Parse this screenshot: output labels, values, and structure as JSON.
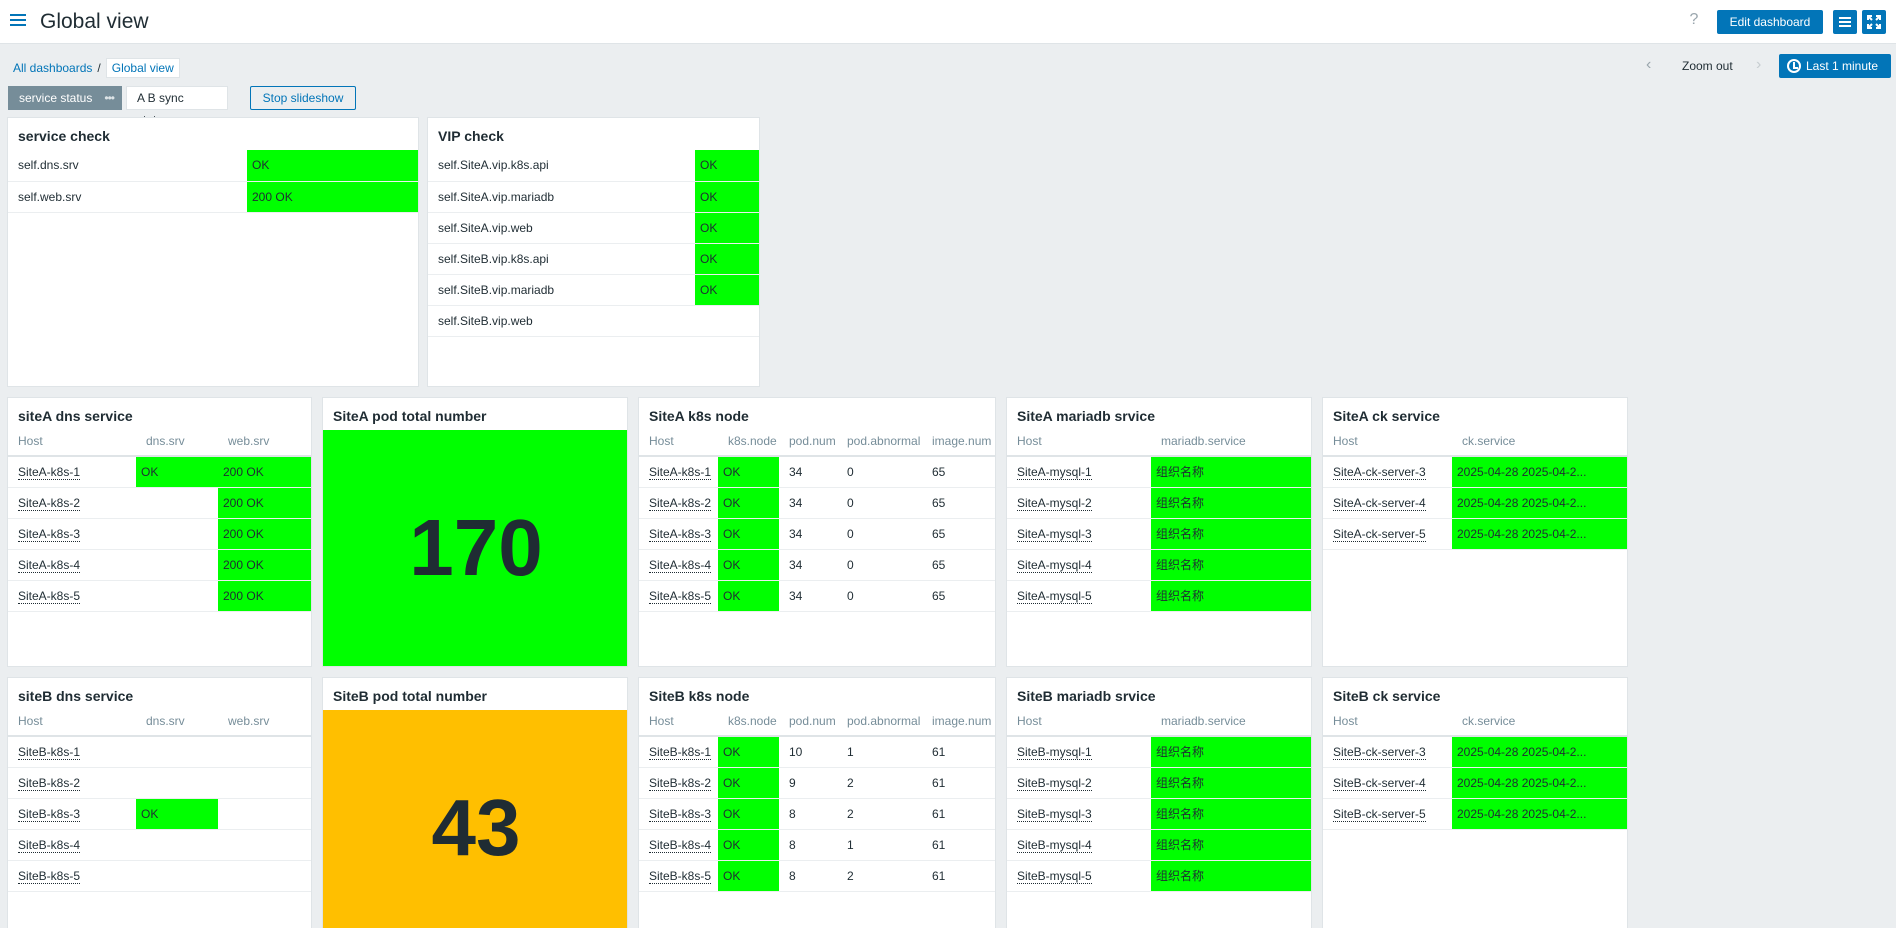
{
  "header": {
    "title": "Global view",
    "help_icon": "?",
    "edit_label": "Edit dashboard"
  },
  "breadcrumb": {
    "all": "All dashboards",
    "separator": "/",
    "current": "Global view"
  },
  "timebar": {
    "zoom_out": "Zoom out",
    "period": "Last 1 minute"
  },
  "tabs": {
    "tab1": "service status",
    "tab1_dots": "•••",
    "tab2": "A B sync status",
    "slideshow": "Stop slideshow"
  },
  "colors": {
    "ok": "#00ff00",
    "warning": "#ffbf00",
    "accent": "#0275b8"
  },
  "service_check": {
    "title": "service check",
    "rows": [
      {
        "name": "self.dns.srv",
        "value": "OK"
      },
      {
        "name": "self.web.srv",
        "value": "200 OK"
      }
    ]
  },
  "vip_check": {
    "title": "VIP check",
    "rows": [
      {
        "name": "self.SiteA.vip.k8s.api",
        "value": "OK"
      },
      {
        "name": "self.SiteA.vip.mariadb",
        "value": "OK"
      },
      {
        "name": "self.SiteA.vip.web",
        "value": "OK"
      },
      {
        "name": "self.SiteB.vip.k8s.api",
        "value": "OK"
      },
      {
        "name": "self.SiteB.vip.mariadb",
        "value": "OK"
      },
      {
        "name": "self.SiteB.vip.web",
        "value": ""
      }
    ]
  },
  "siteA_dns": {
    "title": "siteA dns service",
    "columns": [
      "Host",
      "dns.srv",
      "web.srv"
    ],
    "rows": [
      {
        "host": "SiteA-k8s-1",
        "dns": "OK",
        "web": "200 OK"
      },
      {
        "host": "SiteA-k8s-2",
        "dns": "",
        "web": "200 OK"
      },
      {
        "host": "SiteA-k8s-3",
        "dns": "",
        "web": "200 OK"
      },
      {
        "host": "SiteA-k8s-4",
        "dns": "",
        "web": "200 OK"
      },
      {
        "host": "SiteA-k8s-5",
        "dns": "",
        "web": "200 OK"
      }
    ]
  },
  "siteA_pods": {
    "title": "SiteA pod total number",
    "value": "170"
  },
  "siteA_k8s": {
    "title": "SiteA k8s node",
    "columns": [
      "Host",
      "k8s.node",
      "pod.num",
      "pod.abnormal",
      "image.num"
    ],
    "rows": [
      {
        "host": "SiteA-k8s-1",
        "node": "OK",
        "pod": "34",
        "abn": "0",
        "img": "65"
      },
      {
        "host": "SiteA-k8s-2",
        "node": "OK",
        "pod": "34",
        "abn": "0",
        "img": "65"
      },
      {
        "host": "SiteA-k8s-3",
        "node": "OK",
        "pod": "34",
        "abn": "0",
        "img": "65"
      },
      {
        "host": "SiteA-k8s-4",
        "node": "OK",
        "pod": "34",
        "abn": "0",
        "img": "65"
      },
      {
        "host": "SiteA-k8s-5",
        "node": "OK",
        "pod": "34",
        "abn": "0",
        "img": "65"
      }
    ]
  },
  "siteA_mariadb": {
    "title": "SiteA mariadb srvice",
    "columns": [
      "Host",
      "mariadb.service"
    ],
    "rows": [
      {
        "host": "SiteA-mysql-1",
        "svc": "组织名称"
      },
      {
        "host": "SiteA-mysql-2",
        "svc": "组织名称"
      },
      {
        "host": "SiteA-mysql-3",
        "svc": "组织名称"
      },
      {
        "host": "SiteA-mysql-4",
        "svc": "组织名称"
      },
      {
        "host": "SiteA-mysql-5",
        "svc": "组织名称"
      }
    ]
  },
  "siteA_ck": {
    "title": "SiteA ck service",
    "columns": [
      "Host",
      "ck.service"
    ],
    "rows": [
      {
        "host": "SiteA-ck-server-3",
        "svc": "2025-04-28 2025-04-2..."
      },
      {
        "host": "SiteA-ck-server-4",
        "svc": "2025-04-28 2025-04-2..."
      },
      {
        "host": "SiteA-ck-server-5",
        "svc": "2025-04-28 2025-04-2..."
      }
    ]
  },
  "siteB_dns": {
    "title": "siteB dns service",
    "columns": [
      "Host",
      "dns.srv",
      "web.srv"
    ],
    "rows": [
      {
        "host": "SiteB-k8s-1",
        "dns": "",
        "web": ""
      },
      {
        "host": "SiteB-k8s-2",
        "dns": "",
        "web": ""
      },
      {
        "host": "SiteB-k8s-3",
        "dns": "OK",
        "web": ""
      },
      {
        "host": "SiteB-k8s-4",
        "dns": "",
        "web": ""
      },
      {
        "host": "SiteB-k8s-5",
        "dns": "",
        "web": ""
      }
    ]
  },
  "siteB_pods": {
    "title": "SiteB pod total number",
    "value": "43"
  },
  "siteB_k8s": {
    "title": "SiteB k8s node",
    "columns": [
      "Host",
      "k8s.node",
      "pod.num",
      "pod.abnormal",
      "image.num"
    ],
    "rows": [
      {
        "host": "SiteB-k8s-1",
        "node": "OK",
        "pod": "10",
        "abn": "1",
        "img": "61"
      },
      {
        "host": "SiteB-k8s-2",
        "node": "OK",
        "pod": "9",
        "abn": "2",
        "img": "61"
      },
      {
        "host": "SiteB-k8s-3",
        "node": "OK",
        "pod": "8",
        "abn": "2",
        "img": "61"
      },
      {
        "host": "SiteB-k8s-4",
        "node": "OK",
        "pod": "8",
        "abn": "1",
        "img": "61"
      },
      {
        "host": "SiteB-k8s-5",
        "node": "OK",
        "pod": "8",
        "abn": "2",
        "img": "61"
      }
    ]
  },
  "siteB_mariadb": {
    "title": "SiteB mariadb srvice",
    "columns": [
      "Host",
      "mariadb.service"
    ],
    "rows": [
      {
        "host": "SiteB-mysql-1",
        "svc": "组织名称"
      },
      {
        "host": "SiteB-mysql-2",
        "svc": "组织名称"
      },
      {
        "host": "SiteB-mysql-3",
        "svc": "组织名称"
      },
      {
        "host": "SiteB-mysql-4",
        "svc": "组织名称"
      },
      {
        "host": "SiteB-mysql-5",
        "svc": "组织名称"
      }
    ]
  },
  "siteB_ck": {
    "title": "SiteB ck service",
    "columns": [
      "Host",
      "ck.service"
    ],
    "rows": [
      {
        "host": "SiteB-ck-server-3",
        "svc": "2025-04-28 2025-04-2..."
      },
      {
        "host": "SiteB-ck-server-4",
        "svc": "2025-04-28 2025-04-2..."
      },
      {
        "host": "SiteB-ck-server-5",
        "svc": "2025-04-28 2025-04-2..."
      }
    ]
  }
}
